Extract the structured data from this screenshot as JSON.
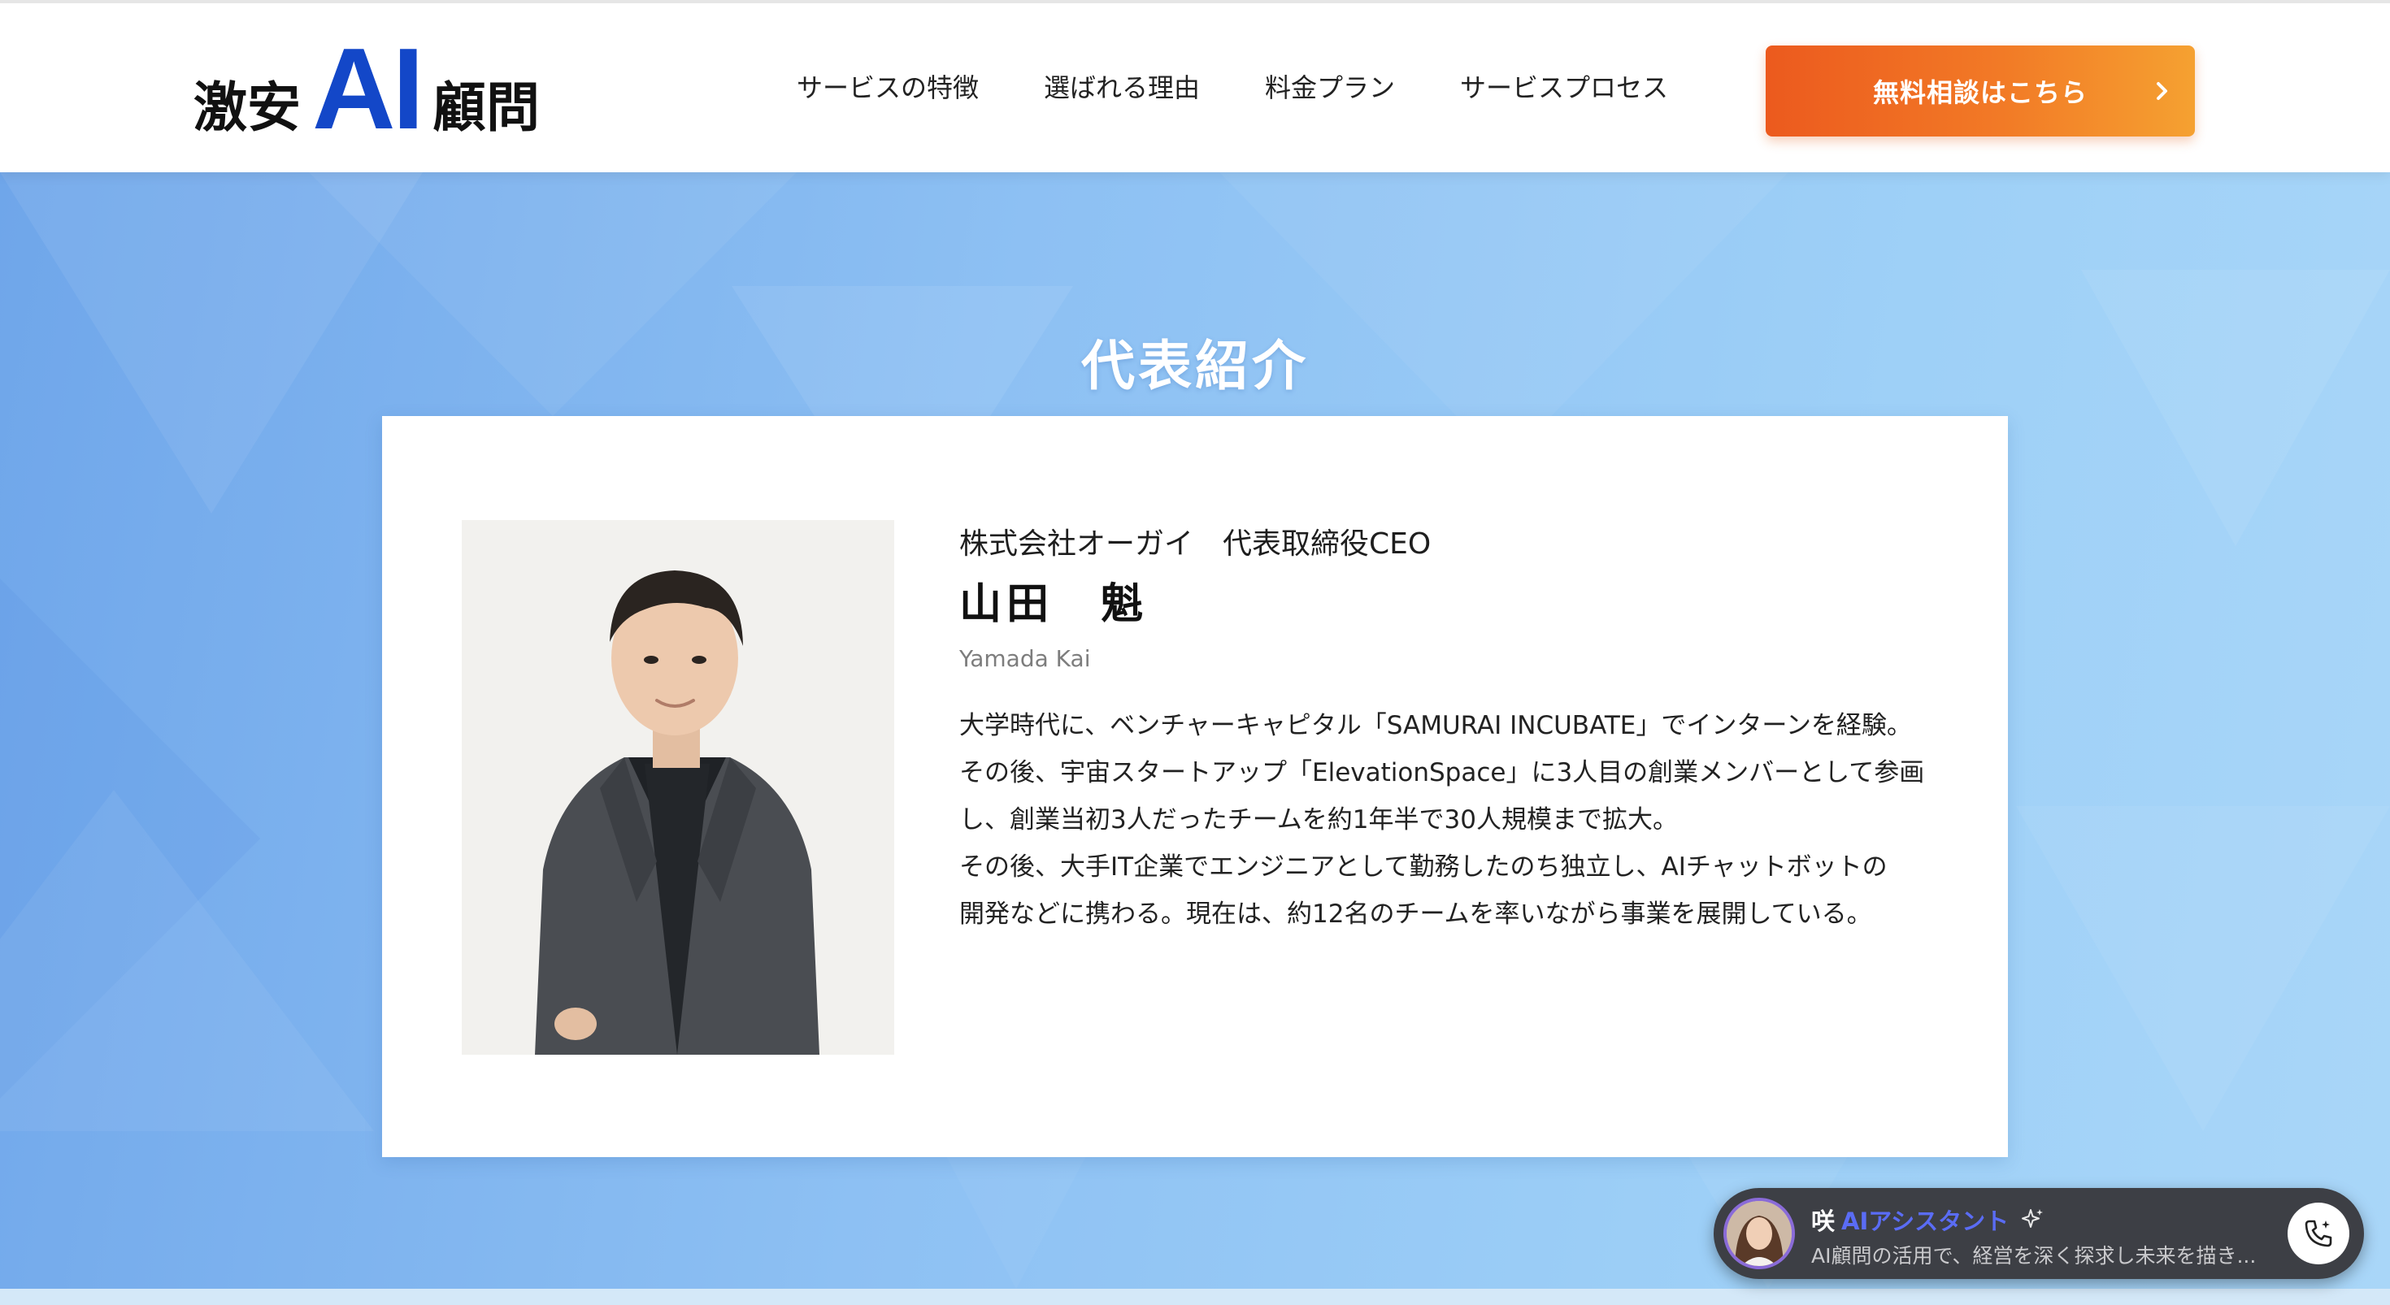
{
  "header": {
    "logo": {
      "prefix": "激安",
      "ai": "AI",
      "suffix": "顧問"
    },
    "nav": [
      {
        "label": "サービスの特徴"
      },
      {
        "label": "選ばれる理由"
      },
      {
        "label": "料金プラン"
      },
      {
        "label": "サービスプロセス"
      }
    ],
    "cta": {
      "label": "無料相談はこちら",
      "icon": "chevron-right-icon"
    }
  },
  "section": {
    "title": "代表紹介"
  },
  "profile": {
    "role": "株式会社オーガイ　代表取締役CEO",
    "name": "山田　魁",
    "romaji": "Yamada Kai",
    "bio": [
      "大学時代に、ベンチャーキャピタル「SAMURAI INCUBATE」でインターンを経験。",
      "その後、宇宙スタートアップ「ElevationSpace」に3人目の創業メンバーとして参画",
      "し、創業当初3人だったチームを約1年半で30人規模まで拡大。",
      "その後、大手IT企業でエンジニアとして勤務したのち独立し、AIチャットボットの",
      "開発などに携わる。現在は、約12名のチームを率いながら事業を展開している。"
    ]
  },
  "chat_widget": {
    "name": "咲",
    "role": "AIアシスタント",
    "subtitle": "AI顧問の活用で、経営を深く探求し未来を描き...",
    "icons": [
      "sparkle-icon",
      "phone-call-icon"
    ]
  },
  "colors": {
    "brand_blue": "#1347c8",
    "cta_start": "#ec5a1e",
    "cta_end": "#f5a131",
    "hero_bg": "#8dc0f3",
    "chat_accent": "#5a6cf5"
  }
}
